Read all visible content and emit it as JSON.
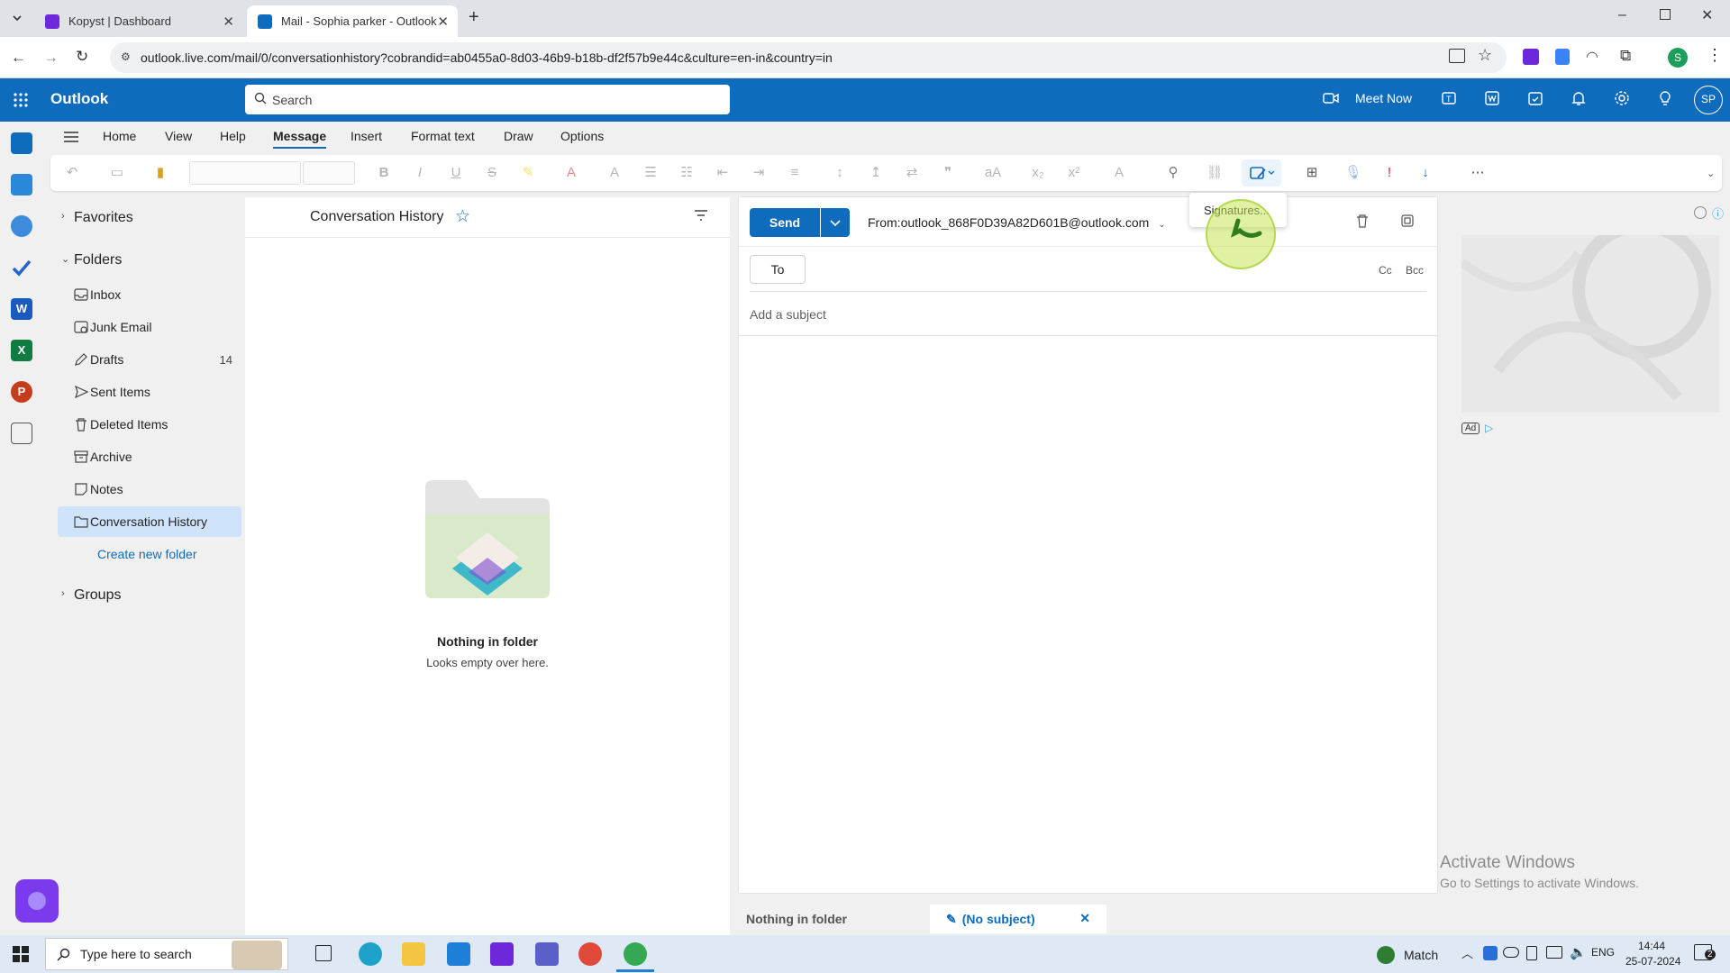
{
  "browser": {
    "tabs": [
      {
        "title": "Kopyst | Dashboard",
        "active": false
      },
      {
        "title": "Mail - Sophia parker - Outlook",
        "active": true
      }
    ],
    "url": "outlook.live.com/mail/0/conversationhistory?cobrandid=ab0455a0-8d03-46b9-b18b-df2f57b9e44c&culture=en-in&country=in",
    "profile_initial": "S"
  },
  "header": {
    "brand": "Outlook",
    "search_placeholder": "Search",
    "meet_now": "Meet Now",
    "avatar_initials": "SP",
    "accent": "#0f6cbd"
  },
  "ribbon": {
    "tabs": [
      "Home",
      "View",
      "Help",
      "Message",
      "Insert",
      "Format text",
      "Draw",
      "Options"
    ],
    "active_tab": "Message"
  },
  "folders": {
    "favorites_label": "Favorites",
    "folders_label": "Folders",
    "items": [
      {
        "label": "Inbox",
        "count": ""
      },
      {
        "label": "Junk Email",
        "count": ""
      },
      {
        "label": "Drafts",
        "count": "14"
      },
      {
        "label": "Sent Items",
        "count": ""
      },
      {
        "label": "Deleted Items",
        "count": ""
      },
      {
        "label": "Archive",
        "count": ""
      },
      {
        "label": "Notes",
        "count": ""
      },
      {
        "label": "Conversation History",
        "count": ""
      }
    ],
    "create_new": "Create new folder",
    "groups_label": "Groups"
  },
  "message_list": {
    "title": "Conversation History",
    "empty_title": "Nothing in folder",
    "empty_subtitle": "Looks empty over here."
  },
  "compose": {
    "send_label": "Send",
    "from_label": "From:",
    "from_address": "outlook_868F0D39A82D601B@outlook.com",
    "to_label": "To",
    "cc_label": "Cc",
    "bcc_label": "Bcc",
    "subject_placeholder": "Add a subject"
  },
  "signatures_menu": {
    "item": "Signatures..."
  },
  "ad": {
    "badge": "Ad"
  },
  "watermark": {
    "line1": "Activate Windows",
    "line2": "Go to Settings to activate Windows."
  },
  "bottom_tabs": {
    "left": "Nothing in folder",
    "right": "(No subject)"
  },
  "taskbar": {
    "search_placeholder": "Type here to search",
    "weather": "Match",
    "language": "ENG",
    "time": "14:44",
    "date": "25-07-2024",
    "notifications": "2"
  }
}
